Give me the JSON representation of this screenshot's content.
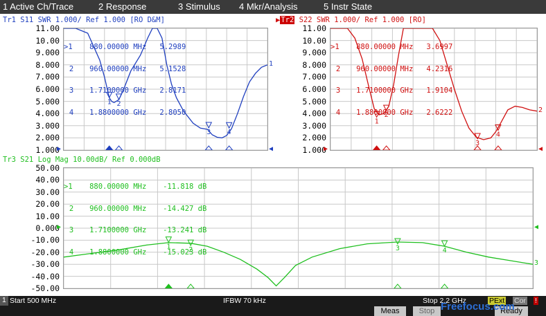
{
  "menu": [
    {
      "num": "1",
      "label": "Active Ch/Trace"
    },
    {
      "num": "2",
      "label": "Response"
    },
    {
      "num": "3",
      "label": "Stimulus"
    },
    {
      "num": "4",
      "label": "Mkr/Analysis"
    },
    {
      "num": "5",
      "label": "Instr State"
    }
  ],
  "panels": {
    "tr1": {
      "title": "Tr1 S11 SWR 1.000/ Ref 1.000 [RO D&M]",
      "color": "#1f3fbf",
      "yticks": [
        "11.00",
        "10.00",
        "9.000",
        "8.000",
        "7.000",
        "6.000",
        "5.000",
        "4.000",
        "3.000",
        "2.000",
        "1.000"
      ],
      "markers": [
        {
          "id": ">1",
          "freq": "880.00000",
          "unit": "MHz",
          "value": "5.2989"
        },
        {
          "id": "2",
          "freq": "960.00000",
          "unit": "MHz",
          "value": "5.1528"
        },
        {
          "id": "3",
          "freq": "1.7100000",
          "unit": "GHz",
          "value": "2.8171"
        },
        {
          "id": "4",
          "freq": "1.8800000",
          "unit": "GHz",
          "value": "2.8050"
        }
      ],
      "end_label": "1"
    },
    "tr2": {
      "badge": "Tr2",
      "title": "S22 SWR 1.000/ Ref 1.000 [RO]",
      "color": "#d01010",
      "yticks": [
        "11.00",
        "10.00",
        "9.000",
        "8.000",
        "7.000",
        "6.000",
        "5.000",
        "4.000",
        "3.000",
        "2.000",
        "1.000"
      ],
      "markers": [
        {
          "id": ">1",
          "freq": "880.00000",
          "unit": "MHz",
          "value": "3.6997"
        },
        {
          "id": "2",
          "freq": "960.00000",
          "unit": "MHz",
          "value": "4.2316"
        },
        {
          "id": "3",
          "freq": "1.7100000",
          "unit": "GHz",
          "value": "1.9104"
        },
        {
          "id": "4",
          "freq": "1.8800000",
          "unit": "GHz",
          "value": "2.6222"
        }
      ],
      "end_label": "2"
    },
    "tr3": {
      "title": "Tr3 S21 Log Mag 10.00dB/ Ref 0.000dB",
      "color": "#1fbf1f",
      "yticks": [
        "50.00",
        "40.00",
        "30.00",
        "20.00",
        "10.00",
        "0.000",
        "-10.00",
        "-20.00",
        "-30.00",
        "-40.00",
        "-50.00"
      ],
      "markers": [
        {
          "id": ">1",
          "freq": "880.00000",
          "unit": "MHz",
          "value": "-11.818 dB"
        },
        {
          "id": "2",
          "freq": "960.00000",
          "unit": "MHz",
          "value": "-14.427 dB"
        },
        {
          "id": "3",
          "freq": "1.7100000",
          "unit": "GHz",
          "value": "-13.241 dB"
        },
        {
          "id": "4",
          "freq": "1.8800000",
          "unit": "GHz",
          "value": "-15.023 dB"
        }
      ],
      "end_label": "3"
    }
  },
  "status": {
    "channel": "1",
    "start": "Start 500 MHz",
    "ifbw": "IFBW 70 kHz",
    "stop": "Stop 2.2 GHz",
    "pext": "PExt",
    "cor": "Cor",
    "excl": "!"
  },
  "buttons": {
    "meas": "Meas",
    "stop": "Stop",
    "ready": "Ready"
  },
  "watermark": "Freefocus.com",
  "chart_data": [
    {
      "type": "line",
      "title": "Tr1 S11 SWR 1.000/ Ref 1.000 [RO D&M]",
      "xlim": [
        0.5,
        2.2
      ],
      "ylim": [
        1,
        11
      ],
      "grid": true,
      "series": [
        {
          "name": "S11",
          "x": [
            0.5,
            0.6,
            0.7,
            0.8,
            0.84,
            0.88,
            0.9,
            0.92,
            0.96,
            1.0,
            1.06,
            1.14,
            1.2,
            1.24,
            1.28,
            1.32,
            1.36,
            1.4,
            1.44,
            1.5,
            1.58,
            1.64,
            1.7,
            1.74,
            1.78,
            1.82,
            1.86,
            1.9,
            1.95,
            2.0,
            2.05,
            2.1,
            2.15,
            2.2
          ],
          "y": [
            11.0,
            11.0,
            10.6,
            8.4,
            7.0,
            5.3,
            5.0,
            4.9,
            5.15,
            6.0,
            7.5,
            8.8,
            10.2,
            11.0,
            11.0,
            10.2,
            8.0,
            6.4,
            5.3,
            4.2,
            3.2,
            2.8,
            2.7,
            2.25,
            2.05,
            2.0,
            2.2,
            2.75,
            4.0,
            5.4,
            6.6,
            7.3,
            7.8,
            8.0
          ]
        }
      ],
      "markers": [
        {
          "x": 0.88,
          "y": 5.2989
        },
        {
          "x": 0.96,
          "y": 5.1528
        },
        {
          "x": 1.71,
          "y": 2.8171
        },
        {
          "x": 1.88,
          "y": 2.805
        }
      ]
    },
    {
      "type": "line",
      "title": "S22 SWR 1.000/ Ref 1.000 [RO]",
      "xlim": [
        0.5,
        2.2
      ],
      "ylim": [
        1,
        11
      ],
      "grid": true,
      "series": [
        {
          "name": "S22",
          "x": [
            0.5,
            0.58,
            0.64,
            0.7,
            0.76,
            0.82,
            0.86,
            0.9,
            0.94,
            0.98,
            1.02,
            1.06,
            1.1,
            1.16,
            1.22,
            1.28,
            1.34,
            1.4,
            1.46,
            1.52,
            1.58,
            1.64,
            1.7,
            1.76,
            1.82,
            1.86,
            1.9,
            1.96,
            2.02,
            2.08,
            2.14,
            2.2
          ],
          "y": [
            11.0,
            11.0,
            11.0,
            10.2,
            8.5,
            6.0,
            4.4,
            3.9,
            4.0,
            4.6,
            6.4,
            8.8,
            11.0,
            11.0,
            11.0,
            11.0,
            11.0,
            10.0,
            8.0,
            6.0,
            4.2,
            2.8,
            2.05,
            1.85,
            2.0,
            2.5,
            3.2,
            4.3,
            4.6,
            4.5,
            4.3,
            4.2
          ]
        }
      ],
      "markers": [
        {
          "x": 0.88,
          "y": 3.6997
        },
        {
          "x": 0.96,
          "y": 4.2316
        },
        {
          "x": 1.71,
          "y": 1.9104
        },
        {
          "x": 1.88,
          "y": 2.6222
        }
      ]
    },
    {
      "type": "line",
      "title": "Tr3 S21 Log Mag 10.00dB/ Ref 0.000dB",
      "xlim": [
        0.5,
        2.2
      ],
      "ylim": [
        -50,
        50
      ],
      "grid": true,
      "series": [
        {
          "name": "S21",
          "x": [
            0.5,
            0.6,
            0.7,
            0.8,
            0.88,
            0.96,
            1.02,
            1.08,
            1.14,
            1.2,
            1.24,
            1.27,
            1.3,
            1.34,
            1.4,
            1.5,
            1.6,
            1.71,
            1.8,
            1.88,
            1.96,
            2.04,
            2.12,
            2.2
          ],
          "y": [
            -24,
            -21,
            -18,
            -14,
            -12,
            -12.5,
            -15,
            -20,
            -26,
            -34,
            -41,
            -48,
            -41,
            -31,
            -24,
            -17,
            -13,
            -11.5,
            -12,
            -15,
            -20,
            -24,
            -27,
            -30
          ]
        }
      ],
      "markers": [
        {
          "x": 0.88,
          "y": -11.818
        },
        {
          "x": 0.96,
          "y": -14.427
        },
        {
          "x": 1.71,
          "y": -13.241
        },
        {
          "x": 1.88,
          "y": -15.023
        }
      ]
    }
  ]
}
